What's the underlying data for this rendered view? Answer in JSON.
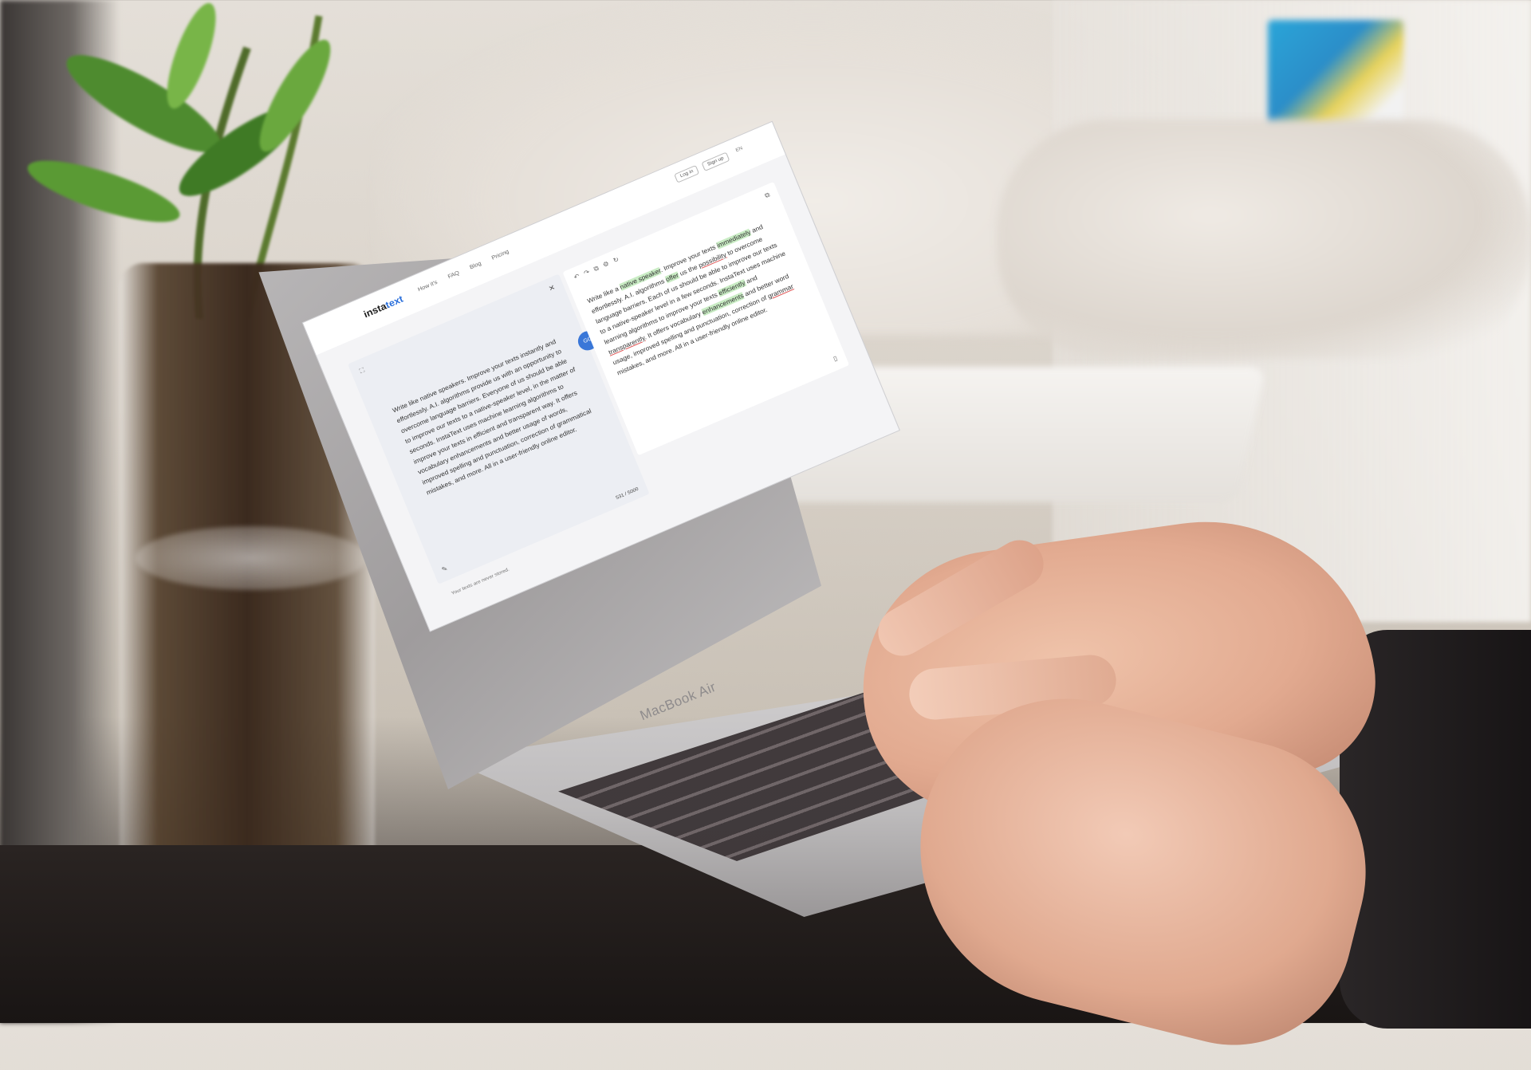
{
  "app": {
    "logo_prefix": "insta",
    "logo_suffix": "text",
    "nav": [
      "How it's",
      "FAQ",
      "Blog",
      "Pricing"
    ],
    "header_buttons": [
      "Log in",
      "Sign up"
    ],
    "language": "EN"
  },
  "editor": {
    "input_text": "Write like native speakers. Improve your texts instantly and effortlessly. A.I. algorithms provide us with an opportunity to overcome language barriers. Everyone of us should be able to improve our texts to a native-speaker level, in the matter of seconds. InstaText uses machine learning algorithms to improve your texts in efficient and transparent way. It offers vocabulary enhancements and better usage of words, improved spelling and punctuation, correction of grammatical mistakes, and more. All in a user-friendly online editor.",
    "char_count": "531 / 5000",
    "go_label": "GO",
    "output_parts": [
      {
        "text": "Write like a ",
        "style": ""
      },
      {
        "text": "native speaker",
        "style": "hl-green"
      },
      {
        "text": ". Improve your texts ",
        "style": ""
      },
      {
        "text": "immediately",
        "style": "hl-green"
      },
      {
        "text": " and effortlessly. A.I. algorithms ",
        "style": ""
      },
      {
        "text": "offer",
        "style": "hl-green"
      },
      {
        "text": " us the ",
        "style": ""
      },
      {
        "text": "possibility",
        "style": "hl-red"
      },
      {
        "text": " to overcome language barriers. Each of us should be able to improve our texts to a native-speaker level in a few seconds. InstaText uses machine learning algorithms to improve your texts ",
        "style": ""
      },
      {
        "text": "efficiently",
        "style": "hl-green"
      },
      {
        "text": " and ",
        "style": ""
      },
      {
        "text": "transparently",
        "style": "hl-red"
      },
      {
        "text": ". It offers vocabulary ",
        "style": ""
      },
      {
        "text": "enhancements",
        "style": "hl-green"
      },
      {
        "text": " and better word usage, improved spelling and punctuation, correction of ",
        "style": ""
      },
      {
        "text": "grammar",
        "style": "hl-red"
      },
      {
        "text": " mistakes, and more. All in a user-friendly online editor.",
        "style": ""
      }
    ],
    "footer_note": "Your texts are never stored."
  },
  "device": {
    "brand": "MacBook Air"
  },
  "icons": {
    "close": "close-icon",
    "copy": "copy-icon",
    "pen": "pen-icon",
    "toolbar": [
      "undo-icon",
      "redo-icon",
      "copy-icon",
      "settings-icon",
      "refresh-icon"
    ]
  }
}
